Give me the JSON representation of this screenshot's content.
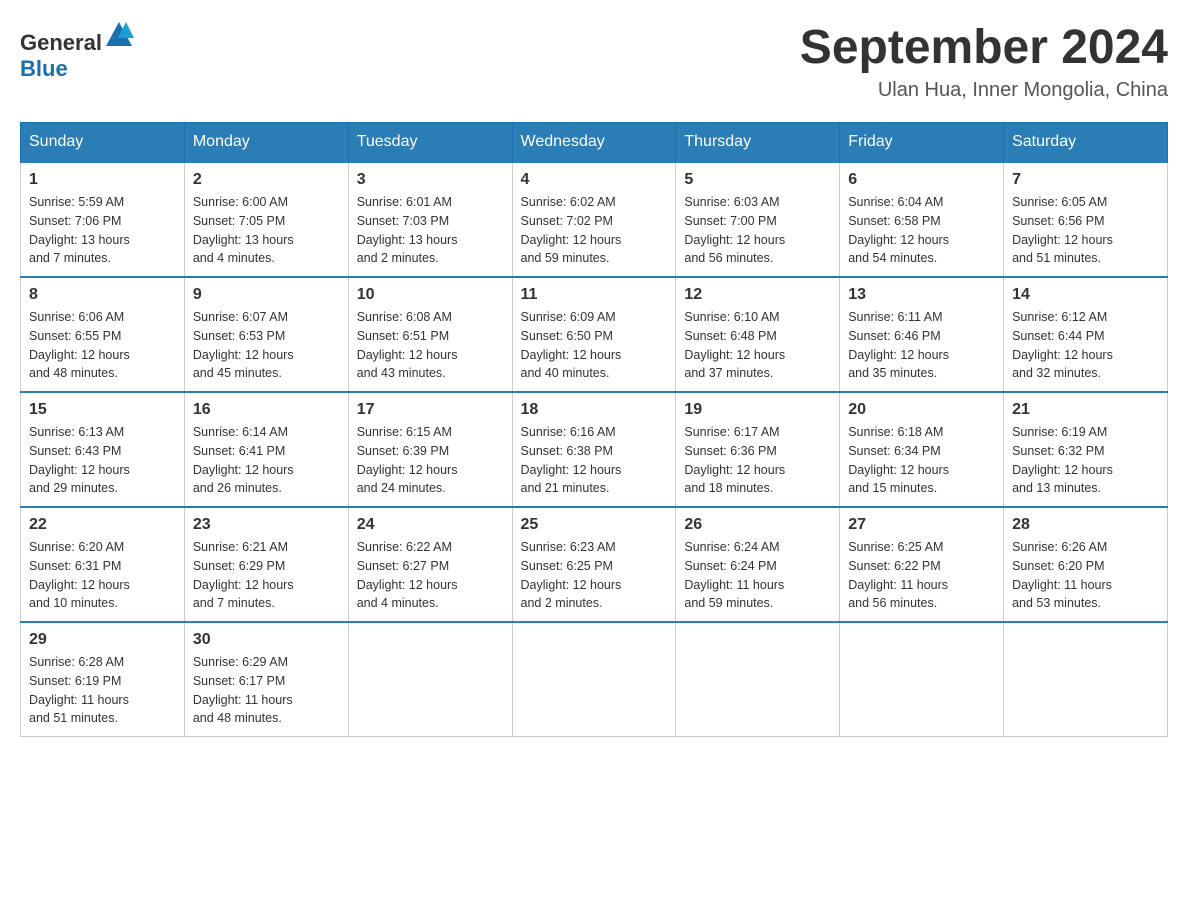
{
  "header": {
    "logo_general": "General",
    "logo_blue": "Blue",
    "month_year": "September 2024",
    "location": "Ulan Hua, Inner Mongolia, China"
  },
  "days_of_week": [
    "Sunday",
    "Monday",
    "Tuesday",
    "Wednesday",
    "Thursday",
    "Friday",
    "Saturday"
  ],
  "weeks": [
    [
      {
        "day": "1",
        "sunrise": "5:59 AM",
        "sunset": "7:06 PM",
        "daylight": "13 hours and 7 minutes."
      },
      {
        "day": "2",
        "sunrise": "6:00 AM",
        "sunset": "7:05 PM",
        "daylight": "13 hours and 4 minutes."
      },
      {
        "day": "3",
        "sunrise": "6:01 AM",
        "sunset": "7:03 PM",
        "daylight": "13 hours and 2 minutes."
      },
      {
        "day": "4",
        "sunrise": "6:02 AM",
        "sunset": "7:02 PM",
        "daylight": "12 hours and 59 minutes."
      },
      {
        "day": "5",
        "sunrise": "6:03 AM",
        "sunset": "7:00 PM",
        "daylight": "12 hours and 56 minutes."
      },
      {
        "day": "6",
        "sunrise": "6:04 AM",
        "sunset": "6:58 PM",
        "daylight": "12 hours and 54 minutes."
      },
      {
        "day": "7",
        "sunrise": "6:05 AM",
        "sunset": "6:56 PM",
        "daylight": "12 hours and 51 minutes."
      }
    ],
    [
      {
        "day": "8",
        "sunrise": "6:06 AM",
        "sunset": "6:55 PM",
        "daylight": "12 hours and 48 minutes."
      },
      {
        "day": "9",
        "sunrise": "6:07 AM",
        "sunset": "6:53 PM",
        "daylight": "12 hours and 45 minutes."
      },
      {
        "day": "10",
        "sunrise": "6:08 AM",
        "sunset": "6:51 PM",
        "daylight": "12 hours and 43 minutes."
      },
      {
        "day": "11",
        "sunrise": "6:09 AM",
        "sunset": "6:50 PM",
        "daylight": "12 hours and 40 minutes."
      },
      {
        "day": "12",
        "sunrise": "6:10 AM",
        "sunset": "6:48 PM",
        "daylight": "12 hours and 37 minutes."
      },
      {
        "day": "13",
        "sunrise": "6:11 AM",
        "sunset": "6:46 PM",
        "daylight": "12 hours and 35 minutes."
      },
      {
        "day": "14",
        "sunrise": "6:12 AM",
        "sunset": "6:44 PM",
        "daylight": "12 hours and 32 minutes."
      }
    ],
    [
      {
        "day": "15",
        "sunrise": "6:13 AM",
        "sunset": "6:43 PM",
        "daylight": "12 hours and 29 minutes."
      },
      {
        "day": "16",
        "sunrise": "6:14 AM",
        "sunset": "6:41 PM",
        "daylight": "12 hours and 26 minutes."
      },
      {
        "day": "17",
        "sunrise": "6:15 AM",
        "sunset": "6:39 PM",
        "daylight": "12 hours and 24 minutes."
      },
      {
        "day": "18",
        "sunrise": "6:16 AM",
        "sunset": "6:38 PM",
        "daylight": "12 hours and 21 minutes."
      },
      {
        "day": "19",
        "sunrise": "6:17 AM",
        "sunset": "6:36 PM",
        "daylight": "12 hours and 18 minutes."
      },
      {
        "day": "20",
        "sunrise": "6:18 AM",
        "sunset": "6:34 PM",
        "daylight": "12 hours and 15 minutes."
      },
      {
        "day": "21",
        "sunrise": "6:19 AM",
        "sunset": "6:32 PM",
        "daylight": "12 hours and 13 minutes."
      }
    ],
    [
      {
        "day": "22",
        "sunrise": "6:20 AM",
        "sunset": "6:31 PM",
        "daylight": "12 hours and 10 minutes."
      },
      {
        "day": "23",
        "sunrise": "6:21 AM",
        "sunset": "6:29 PM",
        "daylight": "12 hours and 7 minutes."
      },
      {
        "day": "24",
        "sunrise": "6:22 AM",
        "sunset": "6:27 PM",
        "daylight": "12 hours and 4 minutes."
      },
      {
        "day": "25",
        "sunrise": "6:23 AM",
        "sunset": "6:25 PM",
        "daylight": "12 hours and 2 minutes."
      },
      {
        "day": "26",
        "sunrise": "6:24 AM",
        "sunset": "6:24 PM",
        "daylight": "11 hours and 59 minutes."
      },
      {
        "day": "27",
        "sunrise": "6:25 AM",
        "sunset": "6:22 PM",
        "daylight": "11 hours and 56 minutes."
      },
      {
        "day": "28",
        "sunrise": "6:26 AM",
        "sunset": "6:20 PM",
        "daylight": "11 hours and 53 minutes."
      }
    ],
    [
      {
        "day": "29",
        "sunrise": "6:28 AM",
        "sunset": "6:19 PM",
        "daylight": "11 hours and 51 minutes."
      },
      {
        "day": "30",
        "sunrise": "6:29 AM",
        "sunset": "6:17 PM",
        "daylight": "11 hours and 48 minutes."
      },
      null,
      null,
      null,
      null,
      null
    ]
  ],
  "labels": {
    "sunrise": "Sunrise:",
    "sunset": "Sunset:",
    "daylight": "Daylight:"
  }
}
